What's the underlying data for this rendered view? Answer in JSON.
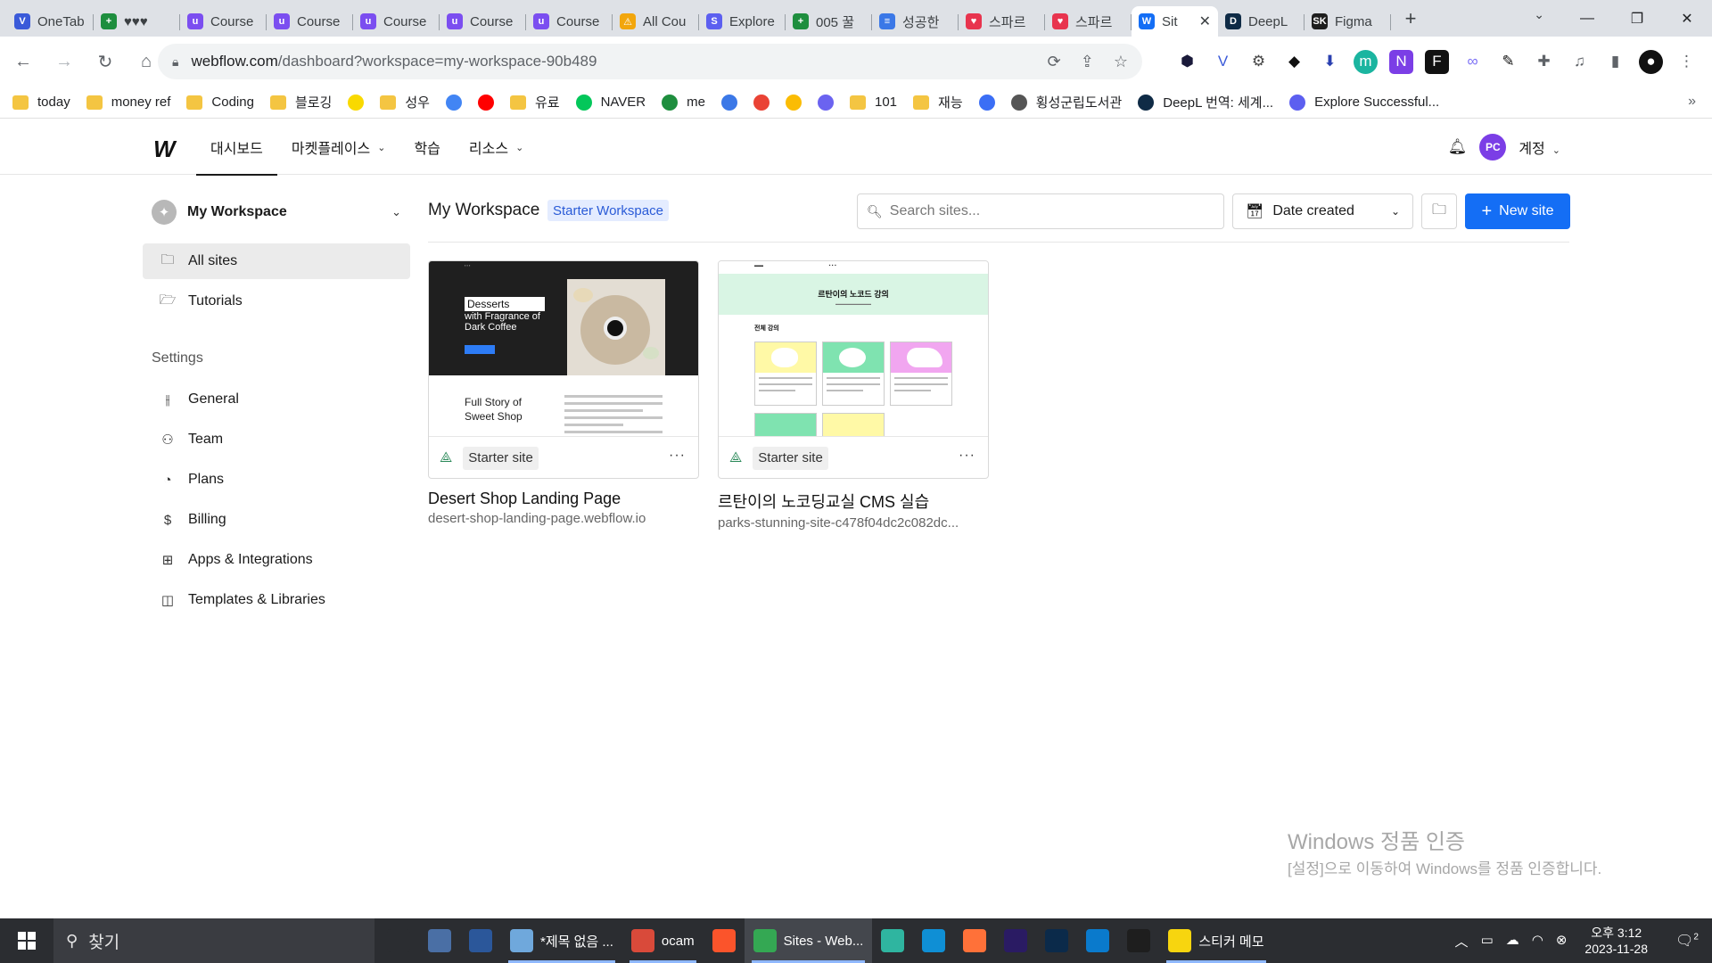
{
  "browser": {
    "tabs": [
      {
        "title": "OneTab",
        "icon": "onetab-icon",
        "color": "#3a5ad9",
        "glyph": "V"
      },
      {
        "title": "♥♥♥",
        "icon": "sheets-icon",
        "color": "#1e8e3e",
        "glyph": "+"
      },
      {
        "title": "Course",
        "icon": "udemy-icon",
        "color": "#7b4ef0",
        "glyph": "u"
      },
      {
        "title": "Course",
        "icon": "udemy-icon",
        "color": "#7b4ef0",
        "glyph": "u"
      },
      {
        "title": "Course",
        "icon": "udemy-icon",
        "color": "#7b4ef0",
        "glyph": "u"
      },
      {
        "title": "Course",
        "icon": "udemy-icon",
        "color": "#7b4ef0",
        "glyph": "u"
      },
      {
        "title": "Course",
        "icon": "udemy-icon",
        "color": "#7b4ef0",
        "glyph": "u"
      },
      {
        "title": "All Cou",
        "icon": "warning-icon",
        "color": "#f2a60c",
        "glyph": "⚠"
      },
      {
        "title": "Explore",
        "icon": "skillshare-icon",
        "color": "#5c5ff0",
        "glyph": "S"
      },
      {
        "title": "005 꿀",
        "icon": "sheets-icon",
        "color": "#1e8e3e",
        "glyph": "+"
      },
      {
        "title": "성공한",
        "icon": "docs-icon",
        "color": "#3b78e7",
        "glyph": "≡"
      },
      {
        "title": "스파르",
        "icon": "sparta-icon",
        "color": "#e8344e",
        "glyph": "♥"
      },
      {
        "title": "스파르",
        "icon": "sparta-icon",
        "color": "#e8344e",
        "glyph": "♥"
      },
      {
        "title": "Sit",
        "icon": "webflow-icon",
        "color": "#146ef5",
        "glyph": "W",
        "active": true
      },
      {
        "title": "DeepL",
        "icon": "deepl-icon",
        "color": "#0f2b46",
        "glyph": "D"
      },
      {
        "title": "Figma",
        "icon": "figma-icon",
        "color": "#1e1e1e",
        "glyph": "SK"
      }
    ],
    "url_host": "webflow.com",
    "url_path": "/dashboard?workspace=my-workspace-90b489",
    "bookmarks": [
      {
        "label": "today",
        "icon": "folder-icon",
        "kind": "folder"
      },
      {
        "label": "money ref",
        "icon": "folder-icon",
        "kind": "folder"
      },
      {
        "label": "Coding",
        "icon": "folder-icon",
        "kind": "folder"
      },
      {
        "label": "블로깅",
        "icon": "folder-icon",
        "kind": "folder"
      },
      {
        "label": "",
        "icon": "kakao-icon",
        "kind": "site",
        "color": "#f9d900"
      },
      {
        "label": "성우",
        "icon": "folder-icon",
        "kind": "folder"
      },
      {
        "label": "",
        "icon": "translate-icon",
        "kind": "site",
        "color": "#4285f4"
      },
      {
        "label": "",
        "icon": "youtube-icon",
        "kind": "site",
        "color": "#ff0000"
      },
      {
        "label": "유료",
        "icon": "folder-icon",
        "kind": "folder"
      },
      {
        "label": "NAVER",
        "icon": "naver-icon",
        "kind": "site",
        "color": "#03c75a"
      },
      {
        "label": "me",
        "icon": "sheets-icon",
        "kind": "site",
        "color": "#1e8e3e"
      },
      {
        "label": "",
        "icon": "docs-icon",
        "kind": "site",
        "color": "#3b78e7"
      },
      {
        "label": "",
        "icon": "google-icon",
        "kind": "site",
        "color": "#ea4335"
      },
      {
        "label": "",
        "icon": "drive-icon",
        "kind": "site",
        "color": "#fbbc04"
      },
      {
        "label": "",
        "icon": "colab-icon",
        "kind": "site",
        "color": "#6b63f0"
      },
      {
        "label": "101",
        "icon": "folder-icon",
        "kind": "folder"
      },
      {
        "label": "재능",
        "icon": "folder-icon",
        "kind": "folder"
      },
      {
        "label": "",
        "icon": "hexagon-icon",
        "kind": "site",
        "color": "#3b6ef5"
      },
      {
        "label": "횡성군립도서관",
        "icon": "globe-icon",
        "kind": "site",
        "color": "#555555"
      },
      {
        "label": "DeepL 번역: 세계...",
        "icon": "deepl-icon",
        "kind": "site",
        "color": "#0f2b46"
      },
      {
        "label": "Explore Successful...",
        "icon": "skillshare-icon",
        "kind": "site",
        "color": "#5c5ff0"
      }
    ]
  },
  "header": {
    "nav": [
      {
        "label": "대시보드",
        "active": true,
        "dropdown": false
      },
      {
        "label": "마켓플레이스",
        "active": false,
        "dropdown": true
      },
      {
        "label": "학습",
        "active": false,
        "dropdown": false
      },
      {
        "label": "리소스",
        "active": false,
        "dropdown": true
      }
    ],
    "avatar_initials": "PC",
    "account_label": "계정"
  },
  "sidebar": {
    "workspace_name": "My Workspace",
    "items": [
      {
        "label": "All sites",
        "icon": "folder-icon",
        "active": true
      },
      {
        "label": "Tutorials",
        "icon": "folder-open-icon",
        "active": false
      }
    ],
    "settings_heading": "Settings",
    "settings": [
      {
        "label": "General",
        "icon": "sliders-icon"
      },
      {
        "label": "Team",
        "icon": "team-icon"
      },
      {
        "label": "Plans",
        "icon": "plans-icon"
      },
      {
        "label": "Billing",
        "icon": "dollar-icon"
      },
      {
        "label": "Apps & Integrations",
        "icon": "apps-icon"
      },
      {
        "label": "Templates & Libraries",
        "icon": "templates-icon"
      }
    ]
  },
  "main": {
    "title": "My Workspace",
    "badge": "Starter Workspace",
    "search_placeholder": "Search sites...",
    "sort_label": "Date created",
    "new_site_label": "New site",
    "sites": [
      {
        "name": "Desert Shop Landing Page",
        "url": "desert-shop-landing-page.webflow.io",
        "tag": "Starter site",
        "thumb": {
          "headline": "Desserts",
          "tagline_1": "with Fragrance of",
          "tagline_2": "Dark Coffee",
          "story_1": "Full Story of",
          "story_2": "Sweet Shop"
        }
      },
      {
        "name": "르탄이의 노코딩교실 CMS 실습",
        "url": "parks-stunning-site-c478f04dc2c082dc...",
        "tag": "Starter site",
        "thumb": {
          "title": "르탄이의 노코드 강의",
          "section": "전체 강의"
        }
      }
    ]
  },
  "watermark": {
    "title": "Windows 정품 인증",
    "subtitle": "[설정]으로 이동하여 Windows를 정품 인증합니다."
  },
  "taskbar": {
    "search_label": "찾기",
    "apps": [
      {
        "label": "",
        "icon": "task-view-icon",
        "color": "#2b2d31"
      },
      {
        "label": "",
        "icon": "calculator-icon",
        "color": "#4a6fa5"
      },
      {
        "label": "",
        "icon": "word-icon",
        "color": "#2b579a"
      },
      {
        "label": "*제목 없음 ...",
        "icon": "notepad-icon",
        "color": "#6fa8dc"
      },
      {
        "label": "ocam",
        "icon": "ocam-icon",
        "color": "#d94a3a"
      },
      {
        "label": "",
        "icon": "brave-icon",
        "color": "#fb542b"
      },
      {
        "label": "Sites - Web...",
        "icon": "chrome-icon",
        "color": "#34a853"
      },
      {
        "label": "",
        "icon": "app-bird-icon",
        "color": "#2fb5a0"
      },
      {
        "label": "",
        "icon": "edge-icon",
        "color": "#0f8fd5"
      },
      {
        "label": "",
        "icon": "firefox-icon",
        "color": "#ff7139"
      },
      {
        "label": "",
        "icon": "after-effects-icon",
        "color": "#2a1b63"
      },
      {
        "label": "",
        "icon": "photoshop-icon",
        "color": "#0b2a4a"
      },
      {
        "label": "",
        "icon": "vscode-icon",
        "color": "#0a7acc"
      },
      {
        "label": "",
        "icon": "figma-icon",
        "color": "#1e1e1e"
      },
      {
        "label": "스티커 메모",
        "icon": "sticky-notes-icon",
        "color": "#f7d50f"
      }
    ],
    "time": "오후 3:12",
    "date": "2023-11-28",
    "notification_count": "2"
  }
}
